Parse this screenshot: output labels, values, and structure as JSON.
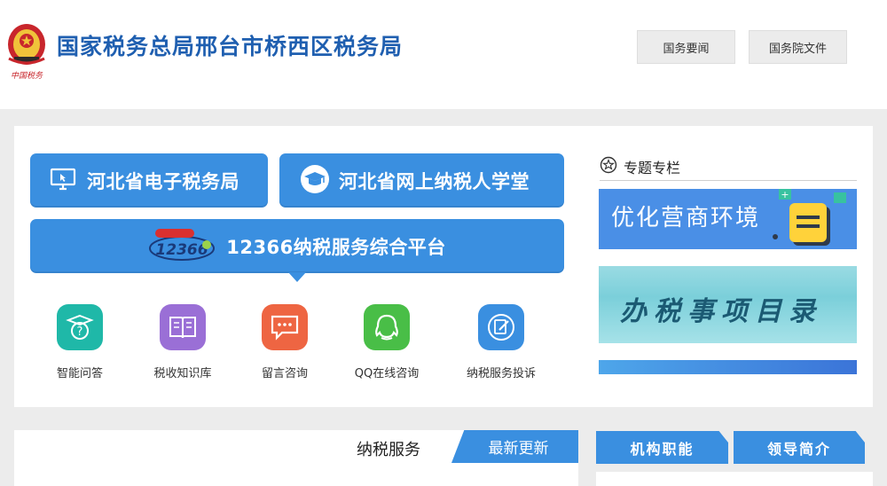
{
  "header": {
    "emblem_caption": "中国税务",
    "title": "国家税务总局邢台市桥西区税务局",
    "nav": [
      "国务要闻",
      "国务院文件"
    ]
  },
  "portals": {
    "etax": "河北省电子税务局",
    "school": "河北省网上纳税人学堂",
    "service_platform": "12366纳税服务综合平台",
    "logo_text": "12366"
  },
  "services": [
    {
      "label": "智能问答",
      "icon": "question-icon",
      "color": "#1fb8a8"
    },
    {
      "label": "税收知识库",
      "icon": "book-icon",
      "color": "#9a6fd6"
    },
    {
      "label": "留言咨询",
      "icon": "message-icon",
      "color": "#ee6542"
    },
    {
      "label": "QQ在线咨询",
      "icon": "qq-icon",
      "color": "#49be47"
    },
    {
      "label": "纳税服务投诉",
      "icon": "complaint-icon",
      "color": "#3a8fe0"
    }
  ],
  "topics": {
    "title": "专题专栏",
    "banners": [
      "优化营商环境",
      "办税事项目录"
    ]
  },
  "bottom": {
    "section_title": "纳税服务",
    "latest_tab": "最新更新",
    "org_functions": "机构职能",
    "leadership": "领导简介"
  },
  "colors": {
    "accent": "#3a8fe0",
    "title_blue": "#1f5fb0",
    "background": "#ececec"
  }
}
